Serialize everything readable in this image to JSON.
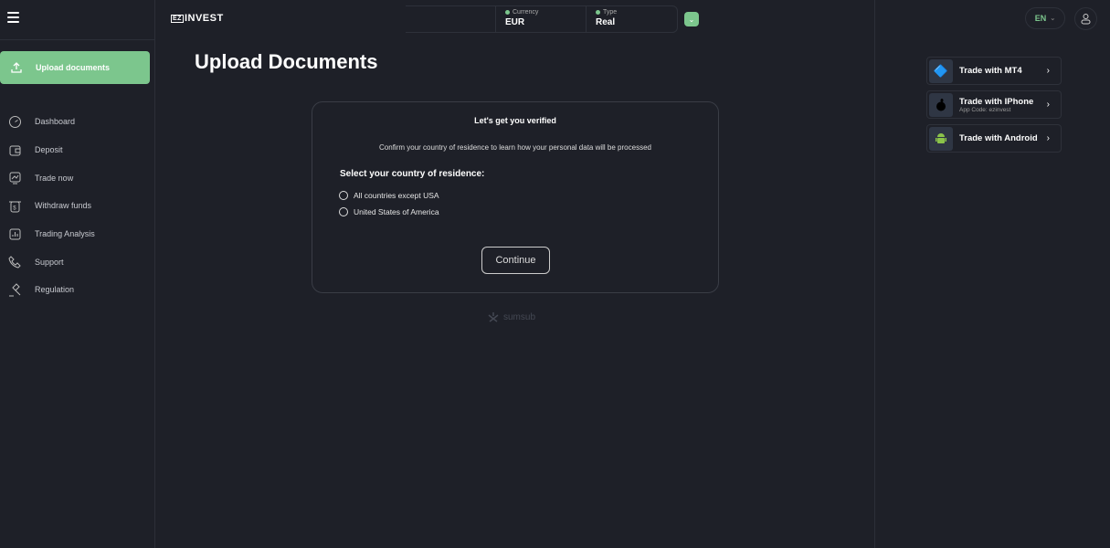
{
  "header": {
    "logo": "INVEST",
    "logo_mark": "EZ",
    "currency_label": "Currency",
    "currency": "EUR",
    "type_label": "Type",
    "type": "Real",
    "lang": "EN"
  },
  "sidebar": {
    "active": "Upload documents",
    "items": [
      {
        "label": "Dashboard",
        "icon": "dashboard-icon"
      },
      {
        "label": "Deposit",
        "icon": "wallet-icon"
      },
      {
        "label": "Trade now",
        "icon": "chart-icon"
      },
      {
        "label": "Withdraw funds",
        "icon": "withdraw-icon"
      },
      {
        "label": "Trading Analysis",
        "icon": "analysis-icon"
      },
      {
        "label": "Support",
        "icon": "phone-icon"
      },
      {
        "label": "Regulation",
        "icon": "gavel-icon"
      }
    ]
  },
  "main": {
    "title": "Upload Documents",
    "card": {
      "title": "Let's get you verified",
      "subtitle": "Confirm your country of residence to learn how your personal data will be processed",
      "question": "Select your country of residence:",
      "options": [
        "All countries except USA",
        "United States of America"
      ],
      "continue": "Continue"
    },
    "powered": "sumsub"
  },
  "right": {
    "items": [
      {
        "label": "Trade with MT4",
        "sub": ""
      },
      {
        "label": "Trade with IPhone",
        "sub": "App Code: ezinvest"
      },
      {
        "label": "Trade with Android",
        "sub": ""
      }
    ]
  },
  "colors": {
    "accent": "#7cc68d",
    "bg": "#1e2028"
  }
}
